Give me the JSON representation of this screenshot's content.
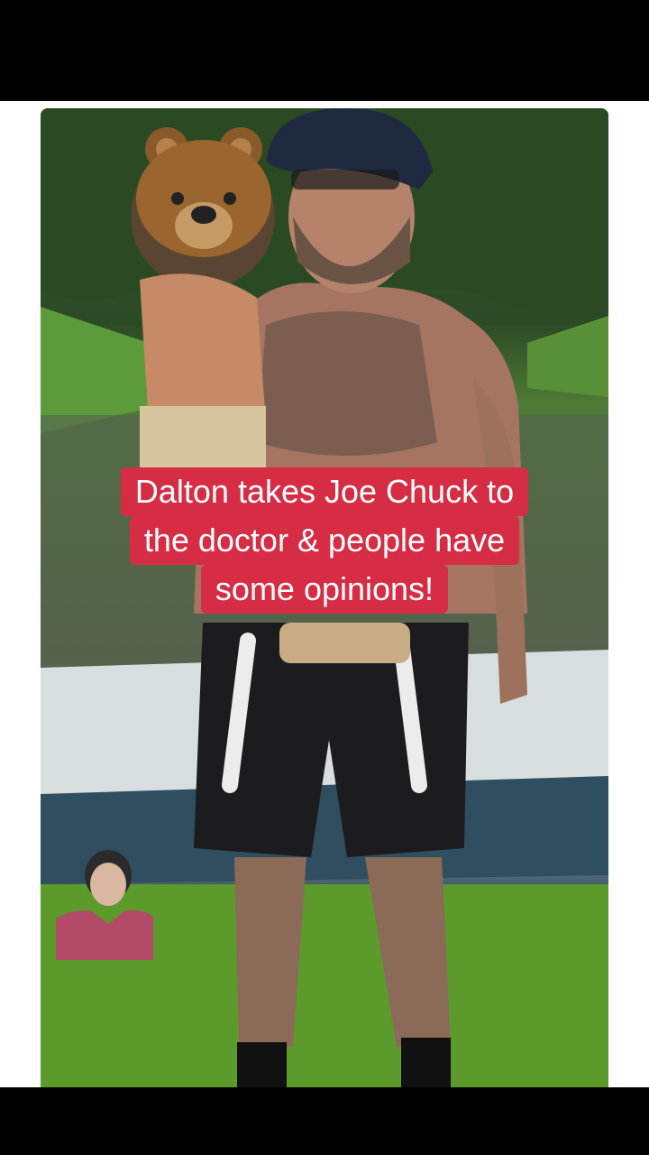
{
  "caption": {
    "lines": [
      "Dalton takes Joe Chuck to",
      "the doctor & people have",
      "some opinions!"
    ],
    "background_color": "#d62d45",
    "text_color": "#ffffff"
  },
  "photo": {
    "overlay_icon": "bear-face-emoji"
  }
}
